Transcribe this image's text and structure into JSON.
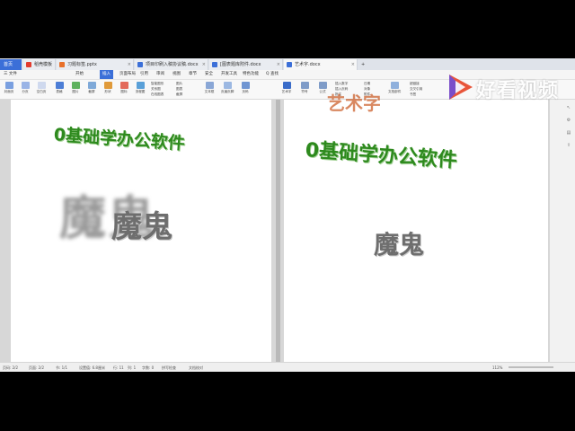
{
  "tabs": {
    "home": "首页",
    "items": [
      "稻壳模板",
      "习题标签.pptx",
      "项目印刷入稿协议稿.docx",
      "[图表题库附件.docx",
      "艺术字.docx"
    ]
  },
  "menus": [
    "三 文件",
    "开始",
    "插入",
    "页面布局",
    "引用",
    "审阅",
    "视图",
    "章节",
    "安全",
    "开发工具",
    "特色功能",
    "Q 查找"
  ],
  "ribbon": {
    "left": [
      "封面页",
      "分页",
      "空白页",
      "表格",
      "图片",
      "截屏",
      "形状",
      "图标",
      "流程图",
      "思维导图",
      "更多"
    ],
    "mid_small": [
      "智能图形",
      "关系图",
      "在线图表",
      "图片",
      "图表",
      "截屏",
      "文本框",
      "页眉页脚",
      "页码"
    ],
    "right": [
      "艺术字",
      "符号",
      "公式",
      "插入数字",
      "批注",
      "附件",
      "对象",
      "文档部件",
      "超链接",
      "书签",
      "交叉引用"
    ],
    "right_small": [
      "插入页码",
      "日期",
      "对象",
      "附件",
      "超链接",
      "交叉引用",
      "书签",
      "文档部件"
    ],
    "share": [
      "未同步",
      "协作",
      "分享"
    ]
  },
  "left_doc": {
    "title": "0基础学办公软件",
    "shadow_word": "魔鬼",
    "word": "魔鬼"
  },
  "right_doc": {
    "header_clip": "艺术字",
    "title": "0基础学办公软件",
    "word": "魔鬼"
  },
  "status": [
    "页码: 2/2",
    "页面: 2/2",
    "节: 1/1",
    "设置值: 6.8厘米",
    "行: 11",
    "列: 1",
    "字数: 0",
    "拼写检查",
    "文档校对"
  ],
  "zoom": "112%",
  "watermark": {
    "text": "好看视频"
  },
  "colors": {
    "green_title": "#2e8a1e",
    "gray_word": "#6e6e6e",
    "shadow_word": "#9a9a9a",
    "accent": "#3b6fd8"
  }
}
